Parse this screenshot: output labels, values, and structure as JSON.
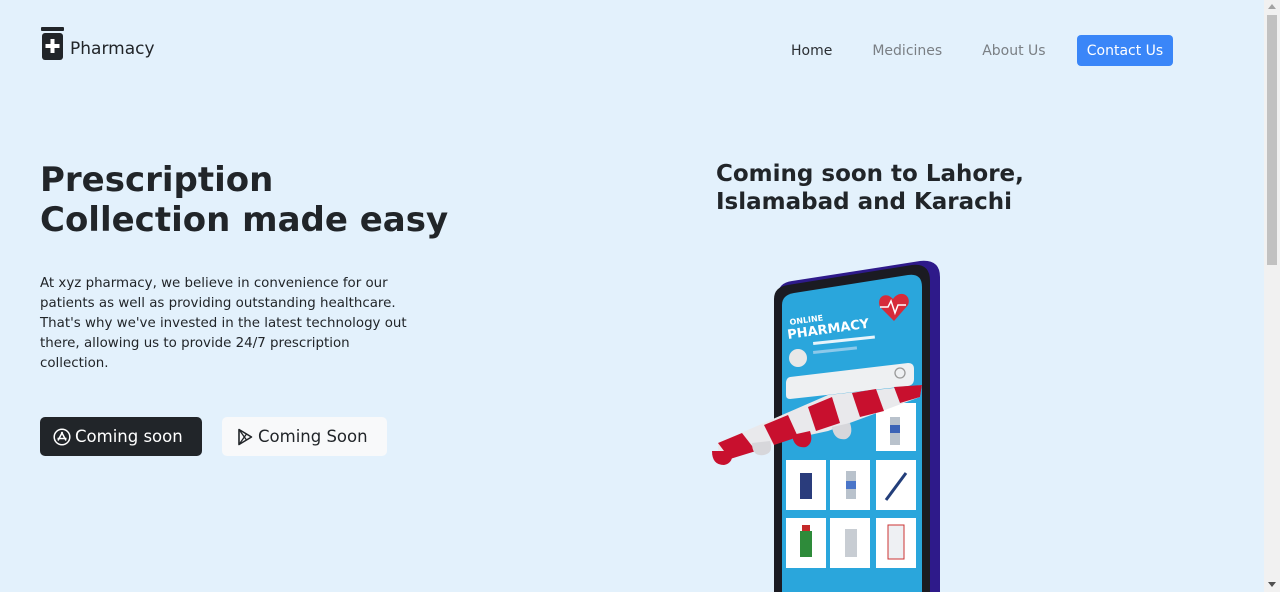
{
  "navbar": {
    "brand": "Pharmacy",
    "brand_icon": "medicine-bottle-icon",
    "links": [
      "Home",
      "Medicines",
      "About Us"
    ],
    "contact_label": "Contact Us"
  },
  "hero": {
    "title": "Prescription Collection made easy",
    "description": "At xyz pharmacy, we believe in convenience for our patients as well as providing outstanding healthcare. That's why we've invested in the latest technology out there, allowing us to provide 24/7 prescription collection.",
    "app_store_label": "Coming soon",
    "play_store_label": "Coming Soon"
  },
  "promo": {
    "title": "Coming soon to Lahore, Islamabad and Karachi",
    "illustration_text_1": "ONLINE",
    "illustration_text_2": "PHARMACY"
  },
  "colors": {
    "background": "#e3f1fc",
    "accent": "#3a86f8",
    "dark": "#212529",
    "awning_red": "#c8102e"
  }
}
